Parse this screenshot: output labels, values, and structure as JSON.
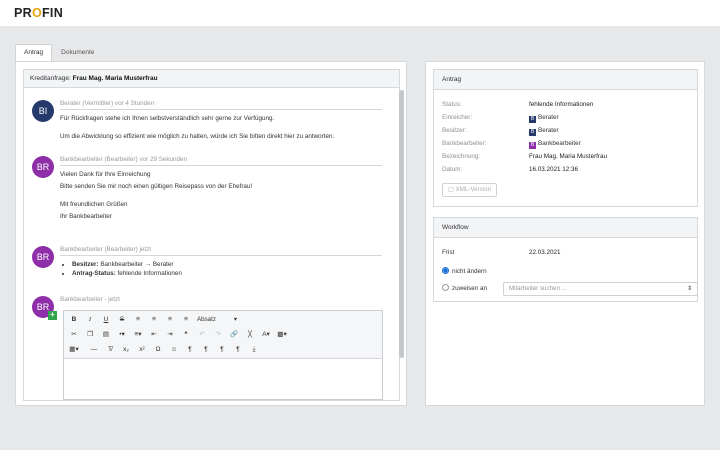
{
  "header": {
    "logo_main": "PR",
    "logo_accent": "O",
    "logo_end": "FIN"
  },
  "tabs": [
    {
      "label": "Antrag"
    },
    {
      "label": "Dokumente"
    }
  ],
  "conversation": {
    "label": "Kreditanfrage:",
    "customer": "Frau Mag. Maria Musterfrau",
    "messages": [
      {
        "initials": "BI",
        "meta": "Berater (Vermittler) vor 4 Stunden",
        "lines": [
          "Für Rückfragen stehe ich Ihnen selbstverständlich sehr gerne zur Verfügung.",
          "Um die Abwicklung so effizient wie möglich zu halten, würde ich Sie bitten direkt hier zu antworten."
        ]
      },
      {
        "initials": "BR",
        "meta": "Bankbearbeiter (Bearbeiter) vor 29 Sekunden",
        "lines": [
          "Vielen Dank für Ihre Einreichung",
          "Bitte senden Sie mir noch einen gültigen Reisepass von der Ehefrau!",
          "Mit freundlichen Grüßen",
          "Ihr Bankbearbeiter"
        ]
      },
      {
        "initials": "BR",
        "meta": "Bankbearbeiter (Bearbeiter) jetzt",
        "changes": [
          {
            "key": "Besitzer:",
            "value": "Bankbearbeiter → Berater"
          },
          {
            "key": "Antrag-Status:",
            "value": "fehlende Informationen"
          }
        ]
      },
      {
        "initials": "BR",
        "meta": "Bankbearbeiter - jetzt"
      }
    ]
  },
  "editor": {
    "format_select": "Absatz"
  },
  "antrag": {
    "title": "Antrag",
    "rows": [
      {
        "label": "Status:",
        "value": "fehlende Informationen"
      },
      {
        "label": "Einreicher:",
        "value": "Berater",
        "badge": "B",
        "badge_color": "#253a6b"
      },
      {
        "label": "Besitzer:",
        "value": "Berater",
        "badge": "B",
        "badge_color": "#253a6b"
      },
      {
        "label": "Bankbearbeiter:",
        "value": "Bankbearbeiter",
        "badge": "B",
        "badge_color": "#8e2ea8"
      },
      {
        "label": "Bezeichnung:",
        "value": "Frau Mag. Maria Musterfrau"
      },
      {
        "label": "Datum:",
        "value": "16.03.2021 12:36"
      }
    ],
    "xml_button": "XML-Version"
  },
  "workflow": {
    "title": "Workflow",
    "frist_label": "Frist",
    "frist_value": "22.03.2021",
    "option_keep": "nicht ändern",
    "option_assign": "zuweisen an",
    "assign_placeholder": "Mitarbeiter suchen ..."
  },
  "colors": {
    "accent": "#e4a00c",
    "navy": "#253a6b",
    "purple": "#8e2ea8",
    "green": "#2fa54a",
    "radio": "#1a6fd6"
  }
}
